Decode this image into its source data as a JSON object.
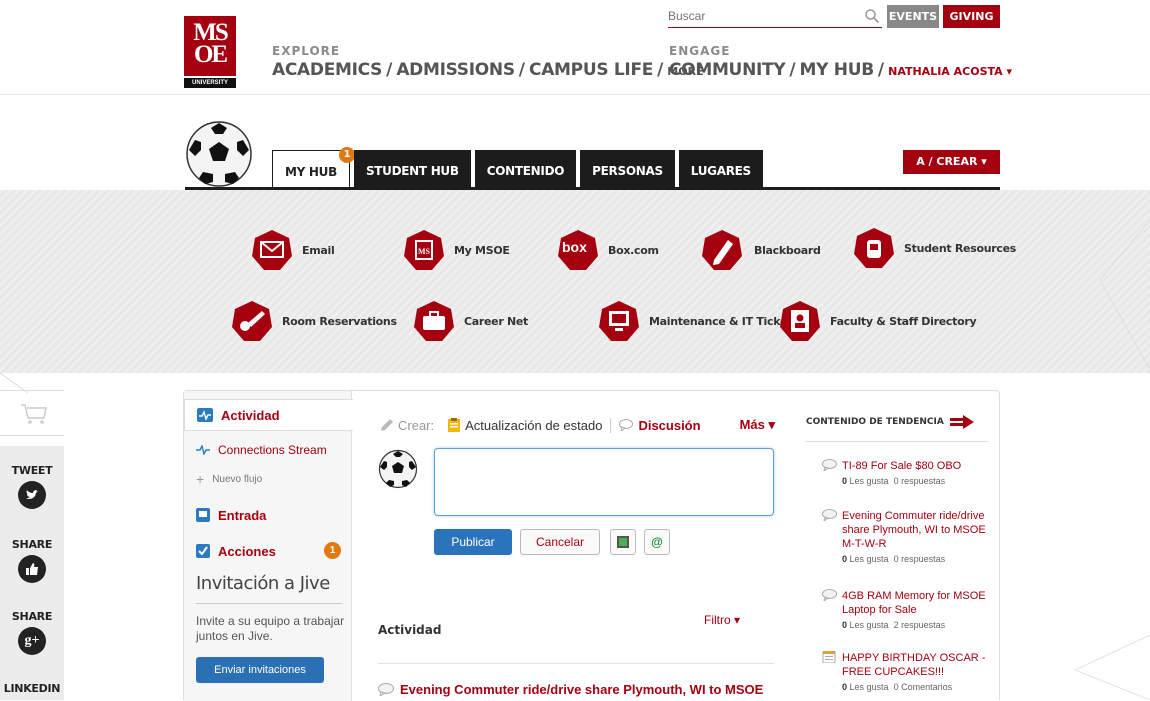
{
  "header": {
    "logo_top": "MS",
    "logo_bottom": "OE",
    "logo_university": "UNIVERSITY",
    "explore_label": "EXPLORE",
    "explore_links": [
      "ACADEMICS",
      "ADMISSIONS",
      "CAMPUS LIFE"
    ],
    "explore_more": "MORE",
    "engage_label": "ENGAGE",
    "engage_links": [
      "COMMUNITY",
      "MY HUB"
    ],
    "user_name": "NATHALIA ACOSTA",
    "search_placeholder": "Buscar",
    "events_label": "EVENTS",
    "giving_label": "GIVING",
    "sep": "/"
  },
  "tabs": {
    "items": [
      "MY HUB",
      "STUDENT HUB",
      "CONTENIDO",
      "PERSONAS",
      "LUGARES"
    ],
    "my_hub_badge": "1",
    "crear_label": "A  ∕  CREAR ▾"
  },
  "launcher": {
    "items": [
      {
        "label": "Email",
        "icon": "envelope-icon"
      },
      {
        "label": "My MSOE",
        "icon": "msoe-icon"
      },
      {
        "label": "Box.com",
        "icon": "box-icon"
      },
      {
        "label": "Blackboard",
        "icon": "pen-icon"
      },
      {
        "label": "Student Resources",
        "icon": "backpack-icon"
      },
      {
        "label": "Room Reservations",
        "icon": "key-icon"
      },
      {
        "label": "Career Net",
        "icon": "briefcase-icon"
      },
      {
        "label": "Maintenance & IT Tickets",
        "icon": "monitor-icon"
      },
      {
        "label": "Faculty & Staff Directory",
        "icon": "directory-icon"
      }
    ],
    "box_text": "box"
  },
  "social": {
    "tweet": "TWEET",
    "share1": "SHARE",
    "share2": "SHARE",
    "linkedin": "LINKEDIN",
    "gplus": "g+"
  },
  "sidebar": {
    "actividad": "Actividad",
    "connections": "Connections Stream",
    "nuevo_flujo": "Nuevo flujo",
    "entrada": "Entrada",
    "acciones": "Acciones",
    "acciones_badge": "1",
    "invite_title": "Invitación a Jive",
    "invite_text": "Invite a su equipo a trabajar juntos en Jive.",
    "invite_button": "Enviar invitaciones"
  },
  "composer": {
    "crear": "Crear:",
    "status_update": "Actualización de estado",
    "discussion": "Discusión",
    "more": "Más ▾",
    "publish": "Publicar",
    "cancel": "Cancelar",
    "mention": "@"
  },
  "activity": {
    "heading": "Actividad",
    "filter": "Filtro ▾",
    "first_item": "Evening Commuter ride/drive share Plymouth, WI to MSOE"
  },
  "trending": {
    "heading": "CONTENIDO DE TENDENCIA",
    "items": [
      {
        "title": "TI-89 For Sale $80 OBO",
        "likes": "0",
        "likes_label": "Les gusta",
        "replies": "0 respuestas"
      },
      {
        "title": "Evening Commuter ride/drive share Plymouth, WI to MSOE M-T-W-R",
        "likes": "0",
        "likes_label": "Les gusta",
        "replies": "0 respuestas"
      },
      {
        "title": "4GB RAM Memory for MSOE Laptop for Sale",
        "likes": "0",
        "likes_label": "Les gusta",
        "replies": "2 respuestas"
      },
      {
        "title": "HAPPY BIRTHDAY OSCAR - FREE CUPCAKES!!!",
        "likes": "0",
        "likes_label": "Les gusta",
        "replies": "0 Comentarios"
      }
    ]
  },
  "colors": {
    "brand_red": "#a40010",
    "dark": "#1c1c1c",
    "accent_blue": "#2b73bb",
    "badge_orange": "#e0790f"
  }
}
